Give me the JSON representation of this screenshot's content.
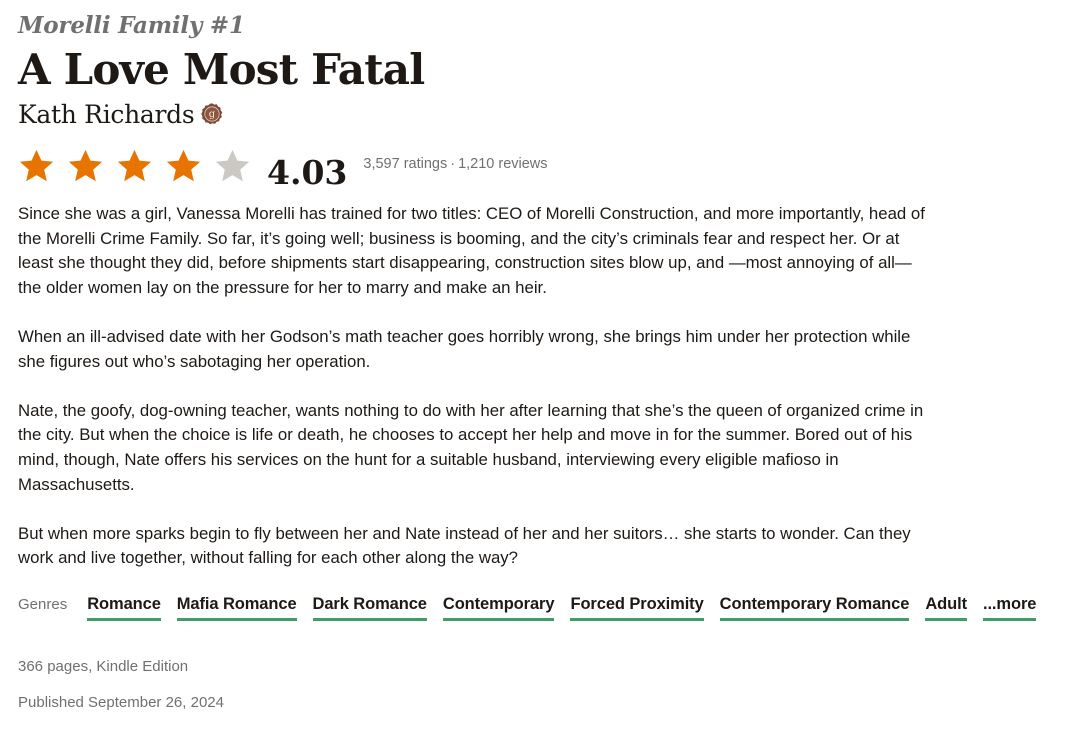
{
  "book": {
    "series": "Morelli Family #1",
    "title": "A Love Most Fatal",
    "author": "Kath Richards",
    "author_badge_icon": "goodreads-author-icon",
    "rating": {
      "average": "4.03",
      "stars_filled": 4,
      "stars_total": 5,
      "ratings_text": "3,597 ratings",
      "separator": "·",
      "reviews_text": "1,210 reviews",
      "star_color": "#e87400",
      "empty_star_color": "#ccc8c4"
    },
    "description": [
      "Since she was a girl, Vanessa Morelli has trained for two titles: CEO of Morelli Construction, and more importantly, head of the Morelli Crime Family. So far, it’s going well; business is booming, and the city’s criminals fear and respect her. Or at least she thought they did, before shipments start disappearing, construction sites blow up, and —most annoying of all—the older women lay on the pressure for her to marry and make an heir.",
      "When an ill-advised date with her Godson’s math teacher goes horribly wrong, she brings him under her protection while she figures out who’s sabotaging her operation.",
      "Nate, the goofy, dog-owning teacher, wants nothing to do with her after learning that she’s the queen of organized crime in the city. But when the choice is life or death, he chooses to accept her help and move in for the summer. Bored out of his mind, though, Nate offers his services on the hunt for a suitable husband, interviewing every eligible mafioso in Massachusetts.",
      "But when more sparks begin to fly between her and Nate instead of her and her suitors… she starts to wonder. Can they work and live together, without falling for each other along the way?"
    ],
    "genres_label": "Genres",
    "genres": [
      "Romance",
      "Mafia Romance",
      "Dark Romance",
      "Contemporary",
      "Forced Proximity",
      "Contemporary Romance",
      "Adult"
    ],
    "genres_more": "...more",
    "genre_underline_color": "#409d69",
    "pages_format": "366 pages, Kindle Edition",
    "published": "Published September 26, 2024"
  }
}
